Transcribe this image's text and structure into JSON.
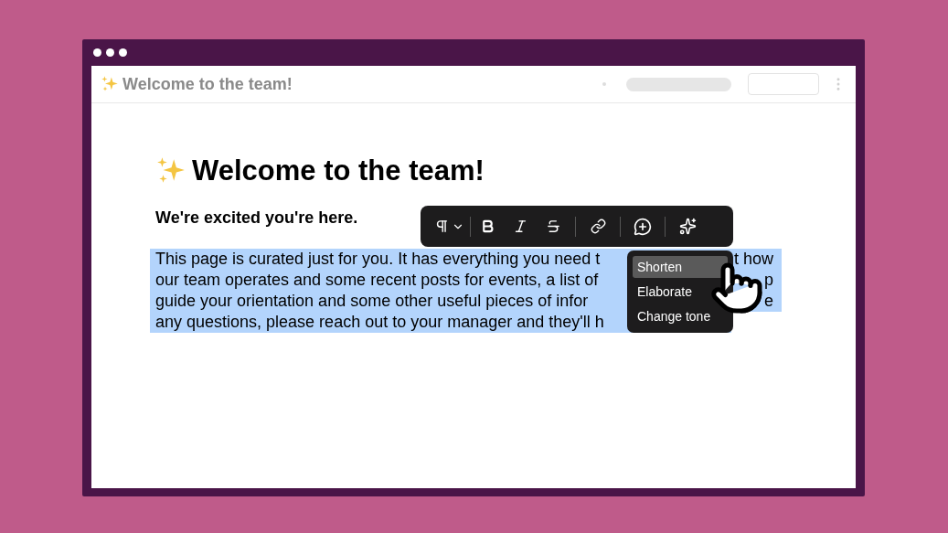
{
  "header": {
    "title": "Welcome to the team!"
  },
  "document": {
    "title": "Welcome to the team!",
    "subtitle": "We're excited you're here.",
    "paragraph_selected": true,
    "paragraph_lines": [
      {
        "text": "This page is curated just for you. It has everything you need t",
        "tail": "t how"
      },
      {
        "text": "our team operates and some recent posts for events, a list of",
        "tail": "p"
      },
      {
        "text": "guide your orientation and some other useful pieces of infor",
        "tail": "e"
      },
      {
        "text": "any questions, please reach out to your manager and they'll h"
      }
    ]
  },
  "ai_menu": {
    "items": [
      {
        "label": "Shorten",
        "selected": true
      },
      {
        "label": "Elaborate",
        "selected": false
      },
      {
        "label": "Change tone",
        "selected": false
      }
    ]
  }
}
